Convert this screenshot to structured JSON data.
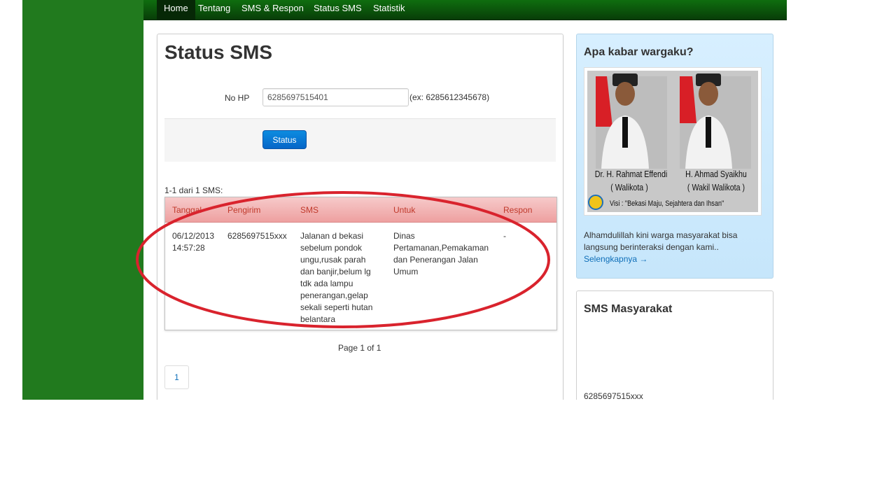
{
  "nav": {
    "items": [
      {
        "label": "Home",
        "active": true
      },
      {
        "label": "Tentang",
        "active": false
      },
      {
        "label": "SMS & Respon",
        "active": false
      },
      {
        "label": "Status SMS",
        "active": false
      },
      {
        "label": "Statistik",
        "active": false
      }
    ]
  },
  "main": {
    "title": "Status SMS",
    "form": {
      "label": "No HP",
      "value": "6285697515401",
      "hint": "(ex: 6285612345678)",
      "button_label": "Status"
    },
    "result_count": "1-1 dari 1 SMS:",
    "table": {
      "headers": [
        "Tanggal",
        "Pengirim",
        "SMS",
        "Untuk",
        "Respon"
      ],
      "rows": [
        {
          "tanggal_date": "06/12/2013",
          "tanggal_time": "14:57:28",
          "pengirim": "6285697515xxx",
          "sms_lines": [
            "Jalanan d bekasi",
            "sebelum pondok",
            "ungu,rusak parah",
            "dan banjir,belum lg",
            "tdk ada lampu",
            "penerangan,gelap",
            "sekali seperti hutan",
            "belantara"
          ],
          "untuk_lines": [
            "Dinas",
            "Pertamanan,Pemakaman",
            "dan Penerangan Jalan",
            "Umum"
          ],
          "respon": "-"
        }
      ]
    },
    "pagination": {
      "summary": "Page 1 of 1",
      "current_page": "1"
    }
  },
  "sidebar": {
    "title": "Apa kabar wargaku?",
    "photo": {
      "leader1_name": "Dr. H. Rahmat Effendi",
      "leader1_role": "( Walikota )",
      "leader2_name": "H. Ahmad Syaikhu",
      "leader2_role": "( Wakil Walikota )",
      "vision": "Visi : \"Bekasi Maju, Sejahtera dan Ihsan\""
    },
    "body_lines": [
      "Alhamdulillah kini warga masyarakat bisa",
      "langsung berinteraksi dengan kami.."
    ],
    "more_link": "Selengkapnya →"
  },
  "sms_card": {
    "title": "SMS Masyarakat",
    "sender": "6285697515xxx"
  },
  "colors": {
    "nav_bg": "#0f6e0f",
    "page_bg": "#217a1e",
    "primary_button": "#0566c8",
    "table_header": "#eea0a0",
    "table_header_text": "#c0392b",
    "annotation": "#d9232d",
    "sidebar_bg": "#d7efff"
  }
}
